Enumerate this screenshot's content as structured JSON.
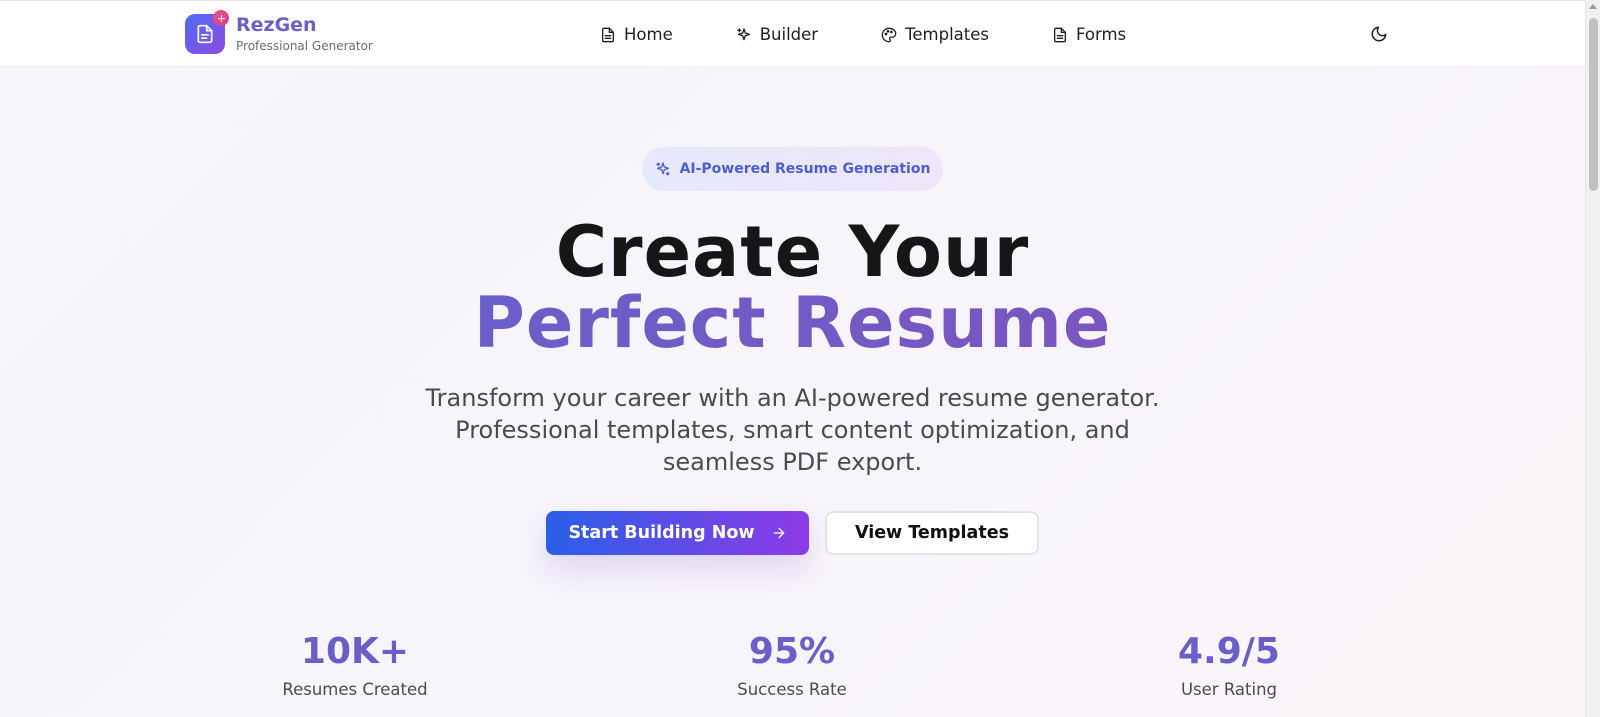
{
  "brand": {
    "name": "RezGen",
    "subtitle": "Professional Generator"
  },
  "nav": {
    "items": [
      {
        "label": "Home",
        "icon": "file-icon"
      },
      {
        "label": "Builder",
        "icon": "sparkles-icon"
      },
      {
        "label": "Templates",
        "icon": "palette-icon"
      },
      {
        "label": "Forms",
        "icon": "file-icon"
      }
    ],
    "theme_toggle_icon": "moon-icon"
  },
  "hero": {
    "badge": "AI-Powered Resume Generation",
    "title_line1": "Create Your",
    "title_line2": "Perfect Resume",
    "description": "Transform your career with an AI-powered resume generator. Professional templates, smart content optimization, and seamless PDF export.",
    "primary_button": "Start Building Now",
    "secondary_button": "View Templates"
  },
  "stats": [
    {
      "value": "10K+",
      "label": "Resumes Created"
    },
    {
      "value": "95%",
      "label": "Success Rate"
    },
    {
      "value": "4.9/5",
      "label": "User Rating"
    }
  ],
  "colors": {
    "brand_purple": "#6a5fc9",
    "gradient_start": "#2a5fe8",
    "gradient_end": "#8e3ae6",
    "badge_text": "#4a5ed0"
  }
}
